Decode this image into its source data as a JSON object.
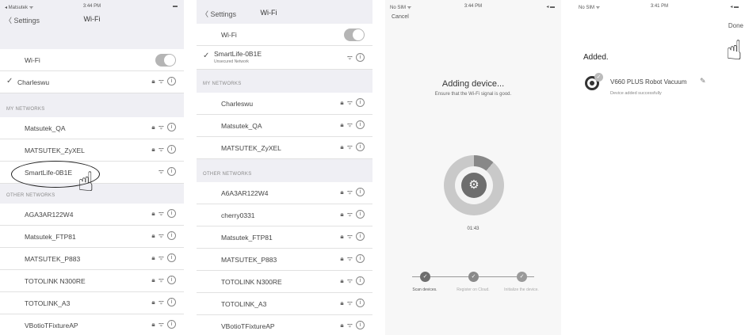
{
  "panel1": {
    "status": {
      "carrier": "◂ Matsutek ᯤ",
      "time": "3:44 PM",
      "battery": "▬"
    },
    "nav": {
      "back": "〈 Settings",
      "title": "Wi-Fi"
    },
    "wifi_label": "Wi-Fi",
    "connected": "Charleswu",
    "my_networks_header": "MY NETWORKS",
    "my_networks": [
      "Matsutek_QA",
      "MATSUTEK_ZyXEL",
      "SmartLife-0B1E"
    ],
    "other_networks_header": "OTHER NETWORKS",
    "other_networks": [
      "AGA3AR122W4",
      "Matsutek_FTP81",
      "MATSUTEK_P883",
      "TOTOLINK N300RE",
      "TOTOLINK_A3",
      "VBotioTFixtureAP"
    ]
  },
  "panel2": {
    "nav": {
      "back": "〈 Settings",
      "title": "Wi-Fi"
    },
    "wifi_label": "Wi-Fi",
    "connected": "SmartLife-0B1E",
    "connected_sub": "Unsecured Network",
    "my_networks_header": "MY NETWORKS",
    "my_networks": [
      "Charleswu",
      "Matsutek_QA",
      "MATSUTEK_ZyXEL"
    ],
    "other_networks_header": "OTHER NETWORKS",
    "other_networks": [
      "A6A3AR122W4",
      "cherry0331",
      "Matsutek_FTP81",
      "MATSUTEK_P883",
      "TOTOLINK N300RE",
      "TOTOLINK_A3",
      "VBotioTFixtureAP"
    ]
  },
  "panel3": {
    "status": {
      "carrier": "No SIM ᯤ",
      "time": "3:44 PM",
      "battery": "◂ ▬"
    },
    "cancel": "Cancel",
    "title": "Adding device...",
    "subtitle": "Ensure that the Wi-Fi signal is good.",
    "timer": "01:43",
    "progress_fraction": 0.11,
    "steps": [
      "Scan devices.",
      "Register on Cloud.",
      "Initialize the device."
    ]
  },
  "panel4": {
    "status": {
      "carrier": "No SIM ᯤ",
      "time": "3:41 PM",
      "battery": "◂ ▬"
    },
    "done": "Done",
    "added": "Added.",
    "device_name": "V660 PLUS Robot Vacuum",
    "device_status": "Device added successfully"
  },
  "icons": {
    "lock": "lock-icon",
    "wifi": "wifi-icon",
    "info": "info-icon",
    "gear": "gear-icon",
    "check": "checkmark-icon",
    "hand": "pointing-hand-icon"
  }
}
